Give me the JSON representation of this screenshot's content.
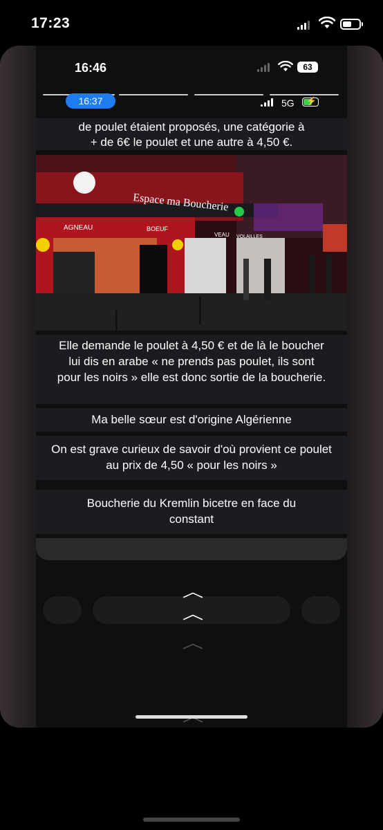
{
  "outer_status": {
    "time": "17:23",
    "signal_icon": "cellular-signal-icon",
    "wifi_icon": "wifi-icon",
    "battery_icon": "battery-icon"
  },
  "inner_status": {
    "time": "16:46",
    "battery_percent": "63"
  },
  "story_header": {
    "pill_time": "16:37",
    "network": "5G"
  },
  "post": {
    "top_text": "de poulet étaient proposés, une catégorie à + de 6€ le poulet et une autre à 4,50 €.",
    "photo": {
      "shop_sign": "Espace ma Boucherie",
      "awning_labels": [
        "AGNEAU",
        "BOEUF",
        "VEAU",
        "VOLAILLES"
      ]
    },
    "paragraph_1": "Elle demande le poulet à 4,50 € et de là le boucher lui dis en arabe « ne prends pas poulet, ils sont pour les noirs » elle est donc sortie de la boucherie.",
    "paragraph_2": "Ma belle sœur est d'origine Algérienne",
    "paragraph_3": "On est grave curieux de savoir d'où provient ce poulet au prix de 4,50  « pour les noirs »",
    "paragraph_4": "Boucherie du Kremlin bicetre en face du constant"
  },
  "colors": {
    "pill_blue": "#1e7cf0",
    "charge_green": "#3ad14a",
    "shop_red": "#c8141e"
  }
}
